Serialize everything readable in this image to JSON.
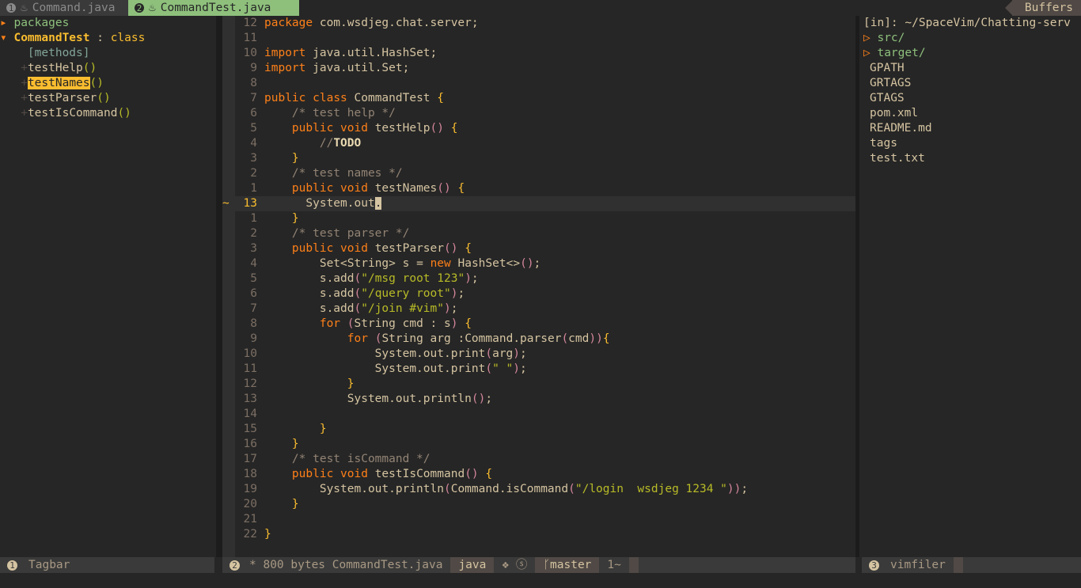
{
  "tabline": {
    "tab1": {
      "num": "1",
      "icon": "java-icon",
      "label": "Command.java"
    },
    "tab2": {
      "num": "2",
      "icon": "java-icon",
      "label": "CommandTest.java"
    },
    "buffers_label": "Buffers"
  },
  "tagbar": {
    "packages": "packages",
    "class_name": "CommandTest",
    "class_sep": " : ",
    "class_kind": "class",
    "methods_header": "[methods]",
    "methods": [
      {
        "name": "testHelp",
        "sig": "()"
      },
      {
        "name": "testNames",
        "sig": "()"
      },
      {
        "name": "testParser",
        "sig": "()"
      },
      {
        "name": "testIsCommand",
        "sig": "()"
      }
    ]
  },
  "editor": {
    "cursor_line_marker": "~",
    "lines": [
      {
        "n": "12",
        "code": "package com.wsdjeg.chat.server;"
      },
      {
        "n": "11",
        "code": ""
      },
      {
        "n": "10",
        "code": "import java.util.HashSet;"
      },
      {
        "n": "9",
        "code": "import java.util.Set;"
      },
      {
        "n": "8",
        "code": ""
      },
      {
        "n": "7",
        "code": "public class CommandTest {"
      },
      {
        "n": "6",
        "code": "    /* test help */"
      },
      {
        "n": "5",
        "code": "    public void testHelp() {"
      },
      {
        "n": "4",
        "code": "        //TODO"
      },
      {
        "n": "3",
        "code": "    }"
      },
      {
        "n": "2",
        "code": "    /* test names */"
      },
      {
        "n": "1",
        "code": "    public void testNames() {"
      },
      {
        "n": "13",
        "code": "      System.out."
      },
      {
        "n": "1",
        "code": "    }"
      },
      {
        "n": "2",
        "code": "    /* test parser */"
      },
      {
        "n": "3",
        "code": "    public void testParser() {"
      },
      {
        "n": "4",
        "code": "        Set<String> s = new HashSet<>();"
      },
      {
        "n": "5",
        "code": "        s.add(\"/msg root 123\");"
      },
      {
        "n": "6",
        "code": "        s.add(\"/query root\");"
      },
      {
        "n": "7",
        "code": "        s.add(\"/join #vim\");"
      },
      {
        "n": "8",
        "code": "        for (String cmd : s) {"
      },
      {
        "n": "9",
        "code": "            for (String arg :Command.parser(cmd)){"
      },
      {
        "n": "10",
        "code": "                System.out.print(arg);"
      },
      {
        "n": "11",
        "code": "                System.out.print(\" \");"
      },
      {
        "n": "12",
        "code": "            }"
      },
      {
        "n": "13",
        "code": "            System.out.println();"
      },
      {
        "n": "14",
        "code": ""
      },
      {
        "n": "15",
        "code": "        }"
      },
      {
        "n": "16",
        "code": "    }"
      },
      {
        "n": "17",
        "code": "    /* test isCommand */"
      },
      {
        "n": "18",
        "code": "    public void testIsCommand() {"
      },
      {
        "n": "19",
        "code": "        System.out.println(Command.isCommand(\"/login  wsdjeg 1234 \"));"
      },
      {
        "n": "20",
        "code": "    }"
      },
      {
        "n": "21",
        "code": ""
      },
      {
        "n": "22",
        "code": "}"
      }
    ]
  },
  "filer": {
    "path": "[in]: ~/SpaceVim/Chatting-serv",
    "dirs": [
      "src/",
      "target/"
    ],
    "dir_marker": "▷",
    "files": [
      "GPATH",
      "GRTAGS",
      "GTAGS",
      "pom.xml",
      "README.md",
      "tags",
      "test.txt"
    ]
  },
  "statusline": {
    "left": {
      "num": "1",
      "label": "Tagbar"
    },
    "center": {
      "num": "2",
      "file_info": "* 800 bytes CommandTest.java",
      "filetype": "java",
      "syntax_icons": "❖ ⓢ",
      "branch_icon": "branch-icon",
      "branch": "master",
      "position": "1~"
    },
    "right": {
      "num": "3",
      "label": "vimfiler"
    }
  },
  "colors": {
    "background": "#262626",
    "tab_active": "#8ec07c",
    "keyword": "#fe8019",
    "type": "#fabd2f",
    "string": "#b8bb26",
    "comment": "#928374",
    "brace": "#d3869b"
  }
}
